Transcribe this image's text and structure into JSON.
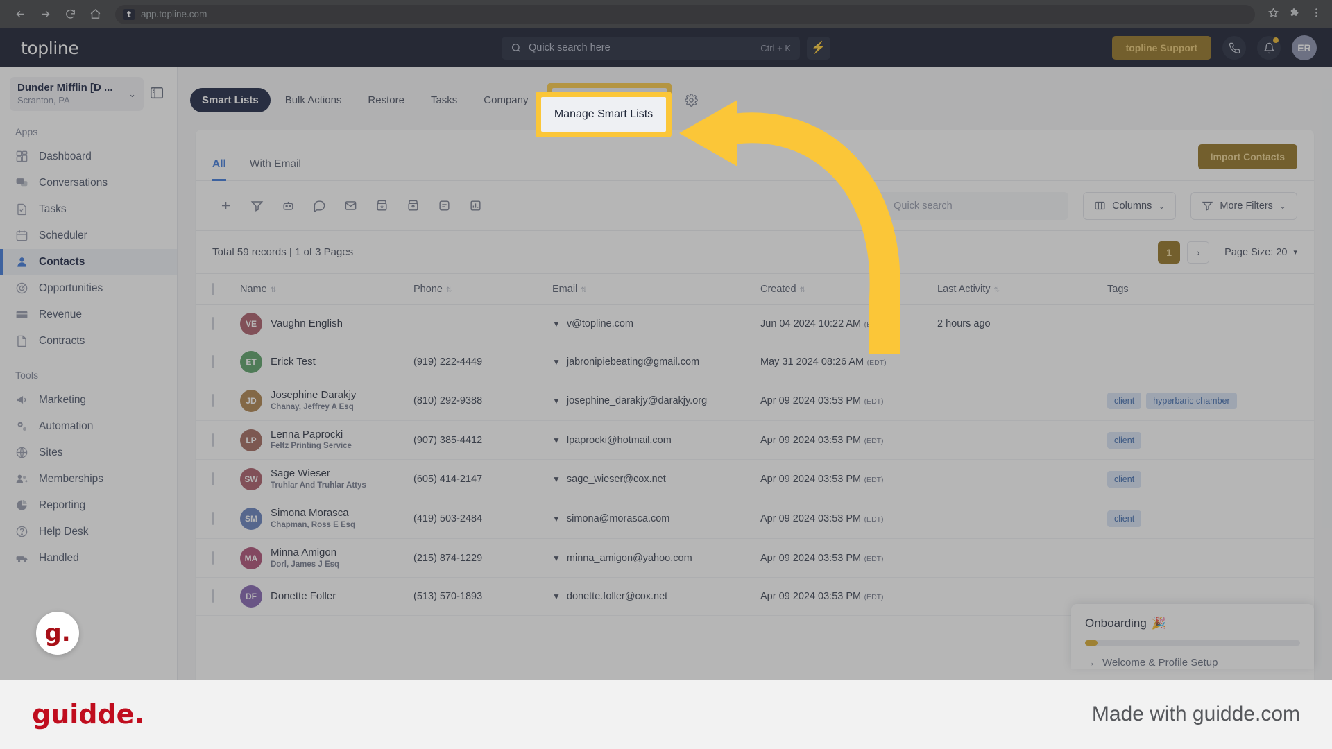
{
  "browser": {
    "url": "app.topline.com",
    "favicon_letter": "t",
    "back_icon": "back-arrow-icon",
    "forward_icon": "forward-arrow-icon",
    "reload_icon": "reload-icon",
    "home_icon": "home-icon",
    "star_icon": "bookmark-star-icon",
    "extensions_icon": "puzzle-extensions-icon",
    "menu_icon": "kebab-menu-icon"
  },
  "topbar": {
    "logo": "topline",
    "search_placeholder": "Quick search here",
    "search_shortcut": "Ctrl + K",
    "bolt_icon": "lightning-bolt-icon",
    "support_label": "topline Support",
    "phone_icon": "phone-icon",
    "bell_icon": "notification-bell-icon",
    "avatar_initials": "ER",
    "accent_gold": "#8c6a14"
  },
  "sidebar": {
    "location_name": "Dunder Mifflin [D ...",
    "location_sub": "Scranton, PA",
    "panel_toggle_icon": "panel-toggle-icon",
    "sections": [
      {
        "title": "Apps",
        "items": [
          {
            "label": "Dashboard",
            "icon": "dashboard-icon",
            "active": false
          },
          {
            "label": "Conversations",
            "icon": "chat-bubbles-icon",
            "active": false
          },
          {
            "label": "Tasks",
            "icon": "task-check-icon",
            "active": false
          },
          {
            "label": "Scheduler",
            "icon": "calendar-icon",
            "active": false
          },
          {
            "label": "Contacts",
            "icon": "person-icon",
            "active": true
          },
          {
            "label": "Opportunities",
            "icon": "target-icon",
            "active": false
          },
          {
            "label": "Revenue",
            "icon": "card-icon",
            "active": false
          },
          {
            "label": "Contracts",
            "icon": "document-icon",
            "active": false
          }
        ]
      },
      {
        "title": "Tools",
        "items": [
          {
            "label": "Marketing",
            "icon": "megaphone-icon",
            "active": false
          },
          {
            "label": "Automation",
            "icon": "gears-icon",
            "active": false
          },
          {
            "label": "Sites",
            "icon": "globe-cursor-icon",
            "active": false
          },
          {
            "label": "Memberships",
            "icon": "members-add-icon",
            "active": false
          },
          {
            "label": "Reporting",
            "icon": "pie-chart-icon",
            "active": false
          },
          {
            "label": "Help Desk",
            "icon": "question-circle-icon",
            "active": false
          },
          {
            "label": "Handled",
            "icon": "handled-icon",
            "active": false
          }
        ]
      }
    ]
  },
  "tabs": {
    "items": [
      {
        "label": "Smart Lists",
        "selected": true
      },
      {
        "label": "Bulk Actions",
        "selected": false
      },
      {
        "label": "Restore",
        "selected": false
      },
      {
        "label": "Tasks",
        "selected": false
      },
      {
        "label": "Company",
        "selected": false
      }
    ],
    "highlighted_label": "Manage Smart Lists",
    "gear_icon": "settings-gear-icon"
  },
  "card": {
    "segments": [
      {
        "label": "All",
        "active": true
      },
      {
        "label": "With Email",
        "active": false
      }
    ],
    "import_label": "Import Contacts",
    "toolbar_icons": [
      "add-plus-icon",
      "filter-funnel-icon",
      "bot-icon",
      "sms-message-icon",
      "email-icon",
      "import-contacts-icon",
      "export-contacts-icon",
      "merge-contacts-icon",
      "bar-chart-icon"
    ],
    "search_placeholder": "Quick search",
    "columns_label": "Columns",
    "more_filters_label": "More Filters",
    "columns_icon": "columns-icon",
    "filter_icon": "filter-funnel-icon",
    "chevron_icon": "chevron-down-icon"
  },
  "pagination": {
    "records_text": "Total 59 records | 1 of 3 Pages",
    "current_page": "1",
    "next_icon": "chevron-right-icon",
    "page_size_label": "Page Size: 20"
  },
  "table": {
    "headers": [
      "Name",
      "Phone",
      "Email",
      "Created",
      "Last Activity",
      "Tags"
    ],
    "rows": [
      {
        "initials": "VE",
        "color": "#a4505e",
        "name": "Vaughn English",
        "company": "",
        "phone": "",
        "email": "v@topline.com",
        "created": "Jun 04 2024 10:22 AM",
        "tz": "(EDT)",
        "last_activity": "2 hours ago",
        "tags": []
      },
      {
        "initials": "ET",
        "color": "#4f9a5c",
        "name": "Erick Test",
        "company": "",
        "phone": "(919) 222-4449",
        "email": "jabronipiebeating@gmail.com",
        "created": "May 31 2024 08:26 AM",
        "tz": "(EDT)",
        "last_activity": "",
        "tags": []
      },
      {
        "initials": "JD",
        "color": "#a8793f",
        "name": "Josephine Darakjy",
        "company": "Chanay, Jeffrey A Esq",
        "phone": "(810) 292-9388",
        "email": "josephine_darakjy@darakjy.org",
        "created": "Apr 09 2024 03:53 PM",
        "tz": "(EDT)",
        "last_activity": "",
        "tags": [
          "client",
          "hyperbaric chamber"
        ]
      },
      {
        "initials": "LP",
        "color": "#9c5d52",
        "name": "Lenna Paprocki",
        "company": "Feltz Printing Service",
        "phone": "(907) 385-4412",
        "email": "lpaprocki@hotmail.com",
        "created": "Apr 09 2024 03:53 PM",
        "tz": "(EDT)",
        "last_activity": "",
        "tags": [
          "client"
        ]
      },
      {
        "initials": "SW",
        "color": "#a4505e",
        "name": "Sage Wieser",
        "company": "Truhlar And Truhlar Attys",
        "phone": "(605) 414-2147",
        "email": "sage_wieser@cox.net",
        "created": "Apr 09 2024 03:53 PM",
        "tz": "(EDT)",
        "last_activity": "",
        "tags": [
          "client"
        ]
      },
      {
        "initials": "SM",
        "color": "#5b77b8",
        "name": "Simona Morasca",
        "company": "Chapman, Ross E Esq",
        "phone": "(419) 503-2484",
        "email": "simona@morasca.com",
        "created": "Apr 09 2024 03:53 PM",
        "tz": "(EDT)",
        "last_activity": "",
        "tags": [
          "client"
        ]
      },
      {
        "initials": "MA",
        "color": "#a8436b",
        "name": "Minna Amigon",
        "company": "Dorl, James J Esq",
        "phone": "(215) 874-1229",
        "email": "minna_amigon@yahoo.com",
        "created": "Apr 09 2024 03:53 PM",
        "tz": "(EDT)",
        "last_activity": "",
        "tags": []
      },
      {
        "initials": "DF",
        "color": "#7a59ab",
        "name": "Donette Foller",
        "company": "",
        "phone": "(513) 570-1893",
        "email": "donette.foller@cox.net",
        "created": "Apr 09 2024 03:53 PM",
        "tz": "(EDT)",
        "last_activity": "",
        "tags": []
      }
    ]
  },
  "onboarding": {
    "title": "Onboarding",
    "title_emoji": "🎉",
    "step_label": "Welcome & Profile Setup",
    "step_arrow_icon": "arrow-right-icon",
    "progress_color": "#d6a41f"
  },
  "guidde": {
    "logo": "guidde.",
    "badge_letter": "g.",
    "tagline": "Made with guidde.com",
    "arrow_icon": "curved-arrow-icon",
    "highlight_color": "#fbc638"
  }
}
